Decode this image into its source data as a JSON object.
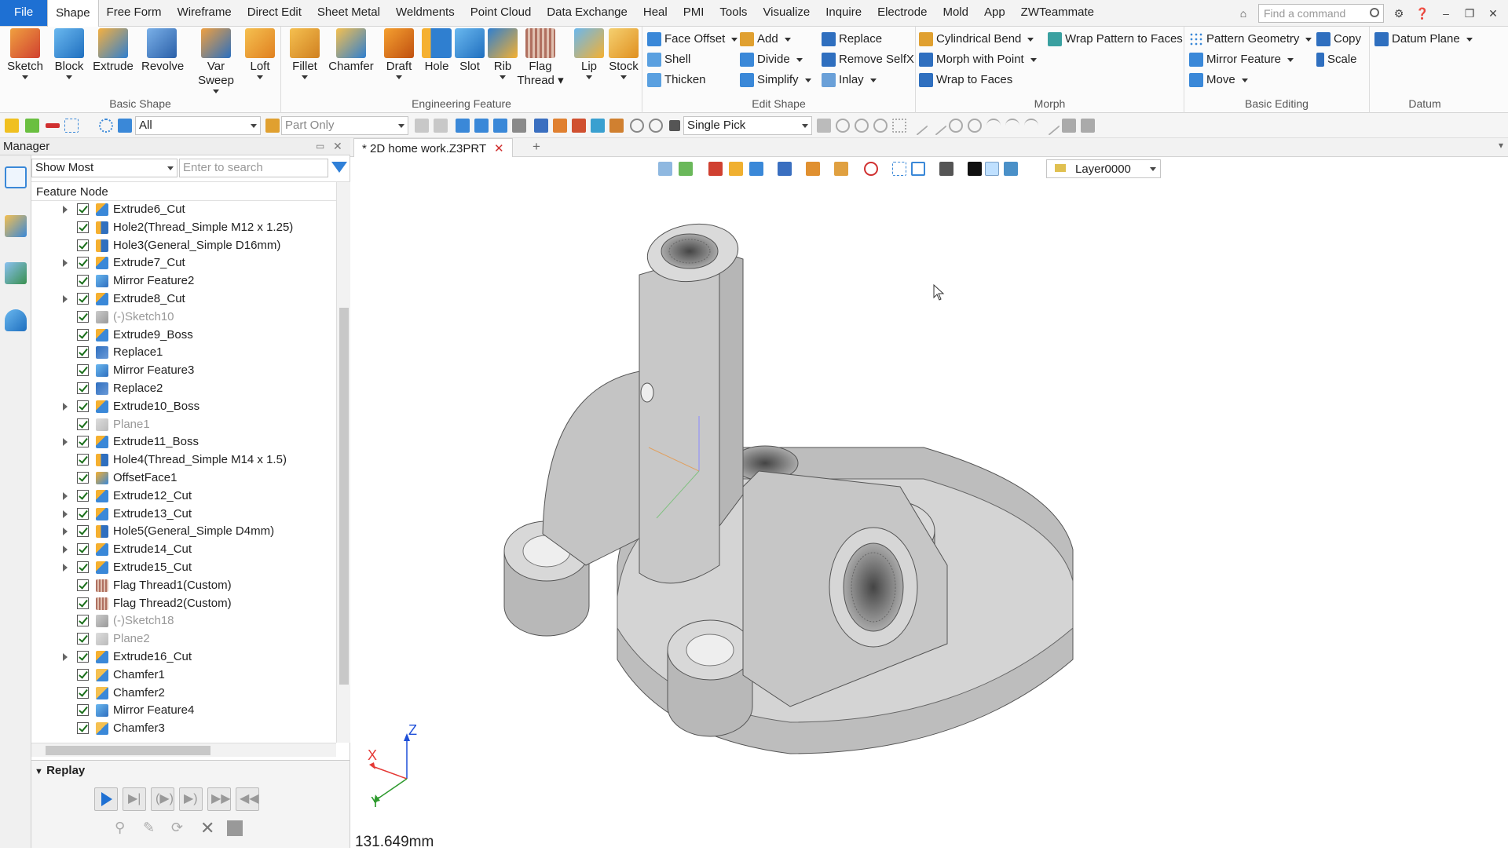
{
  "menubar": {
    "items": [
      "File",
      "Shape",
      "Free Form",
      "Wireframe",
      "Direct Edit",
      "Sheet Metal",
      "Weldments",
      "Point Cloud",
      "Data Exchange",
      "Heal",
      "PMI",
      "Tools",
      "Visualize",
      "Inquire",
      "Electrode",
      "Mold",
      "App",
      "ZWTeammate"
    ],
    "active": "Shape",
    "search_placeholder": "Find a command"
  },
  "ribbon": {
    "basic_shape": {
      "label": "Basic Shape",
      "buttons": [
        "Sketch",
        "Block",
        "Extrude",
        "Revolve",
        "Var Sweep",
        "Loft"
      ]
    },
    "engineering_feature": {
      "label": "Engineering Feature",
      "buttons": [
        "Fillet",
        "Chamfer",
        "Draft",
        "Hole",
        "Slot",
        "Rib",
        "Flag",
        "Thread",
        "Lip",
        "Stock"
      ]
    },
    "edit_shape": {
      "label": "Edit Shape",
      "buttons": [
        "Face Offset",
        "Shell",
        "Thicken",
        "Add",
        "Divide",
        "Simplify",
        "Replace",
        "Remove SelfX",
        "Inlay"
      ]
    },
    "morph": {
      "label": "Morph",
      "buttons": [
        "Cylindrical Bend",
        "Morph with Point",
        "Wrap to Faces",
        "Wrap Pattern to Faces"
      ]
    },
    "basic_editing": {
      "label": "Basic Editing",
      "buttons": [
        "Pattern Geometry",
        "Mirror Feature",
        "Move",
        "Copy",
        "Scale"
      ]
    },
    "datum": {
      "label": "Datum",
      "buttons": [
        "Datum Plane"
      ]
    }
  },
  "toolbar2": {
    "filter_value": "All",
    "scope_value": "Part Only",
    "pick_value": "Single Pick"
  },
  "manager": {
    "title": "Manager",
    "show_select": "Show Most",
    "search_placeholder": "Enter to search",
    "header": "Feature Node",
    "nodes": [
      {
        "label": "Extrude6_Cut",
        "expandable": true,
        "icon": "extrude-icon",
        "dim": false
      },
      {
        "label": "Hole2(Thread_Simple M12 x 1.25)",
        "expandable": false,
        "icon": "hole-icon",
        "dim": false
      },
      {
        "label": "Hole3(General_Simple D16mm)",
        "expandable": false,
        "icon": "hole-icon",
        "dim": false
      },
      {
        "label": "Extrude7_Cut",
        "expandable": true,
        "icon": "extrude-icon",
        "dim": false
      },
      {
        "label": "Mirror Feature2",
        "expandable": false,
        "icon": "mirror-icon",
        "dim": false
      },
      {
        "label": "Extrude8_Cut",
        "expandable": true,
        "icon": "extrude-icon",
        "dim": false
      },
      {
        "label": "(-)Sketch10",
        "expandable": false,
        "icon": "sketch-icon",
        "dim": true
      },
      {
        "label": "Extrude9_Boss",
        "expandable": false,
        "icon": "extrude-icon",
        "dim": false
      },
      {
        "label": "Replace1",
        "expandable": false,
        "icon": "replace-icon",
        "dim": false
      },
      {
        "label": "Mirror Feature3",
        "expandable": false,
        "icon": "mirror-icon",
        "dim": false
      },
      {
        "label": "Replace2",
        "expandable": false,
        "icon": "replace-icon",
        "dim": false
      },
      {
        "label": "Extrude10_Boss",
        "expandable": true,
        "icon": "extrude-icon",
        "dim": false
      },
      {
        "label": "Plane1",
        "expandable": false,
        "icon": "plane-icon",
        "dim": true
      },
      {
        "label": "Extrude11_Boss",
        "expandable": true,
        "icon": "extrude-icon",
        "dim": false
      },
      {
        "label": "Hole4(Thread_Simple M14 x 1.5)",
        "expandable": false,
        "icon": "hole-icon",
        "dim": false
      },
      {
        "label": "OffsetFace1",
        "expandable": false,
        "icon": "offset-icon",
        "dim": false
      },
      {
        "label": "Extrude12_Cut",
        "expandable": true,
        "icon": "extrude-icon",
        "dim": false
      },
      {
        "label": "Extrude13_Cut",
        "expandable": true,
        "icon": "extrude-icon",
        "dim": false
      },
      {
        "label": "Hole5(General_Simple D4mm)",
        "expandable": true,
        "icon": "hole-icon",
        "dim": false
      },
      {
        "label": "Extrude14_Cut",
        "expandable": true,
        "icon": "extrude-icon",
        "dim": false
      },
      {
        "label": "Extrude15_Cut",
        "expandable": true,
        "icon": "extrude-icon",
        "dim": false
      },
      {
        "label": "Flag Thread1(Custom)",
        "expandable": false,
        "icon": "thread-icon",
        "dim": false
      },
      {
        "label": "Flag Thread2(Custom)",
        "expandable": false,
        "icon": "thread-icon",
        "dim": false
      },
      {
        "label": "(-)Sketch18",
        "expandable": false,
        "icon": "sketch-icon",
        "dim": true
      },
      {
        "label": "Plane2",
        "expandable": false,
        "icon": "plane-icon",
        "dim": true
      },
      {
        "label": "Extrude16_Cut",
        "expandable": true,
        "icon": "extrude-icon",
        "dim": false
      },
      {
        "label": "Chamfer1",
        "expandable": false,
        "icon": "chamfer-icon",
        "dim": false
      },
      {
        "label": "Chamfer2",
        "expandable": false,
        "icon": "chamfer-icon",
        "dim": false
      },
      {
        "label": "Mirror Feature4",
        "expandable": false,
        "icon": "mirror-icon",
        "dim": false
      },
      {
        "label": "Chamfer3",
        "expandable": false,
        "icon": "chamfer-icon",
        "dim": false
      }
    ]
  },
  "replay": {
    "title": "Replay"
  },
  "document": {
    "tab_label": "* 2D home work.Z3PRT",
    "layer": "Layer0000",
    "measure": "131.649mm",
    "axes": {
      "x": "X",
      "y": "Y",
      "z": "Z"
    }
  },
  "colors": {
    "accent": "#1e70d3",
    "axis_x": "#e53935",
    "axis_y": "#2e9a2e",
    "axis_z": "#1e4fd8",
    "part": "#c4c4c4"
  }
}
